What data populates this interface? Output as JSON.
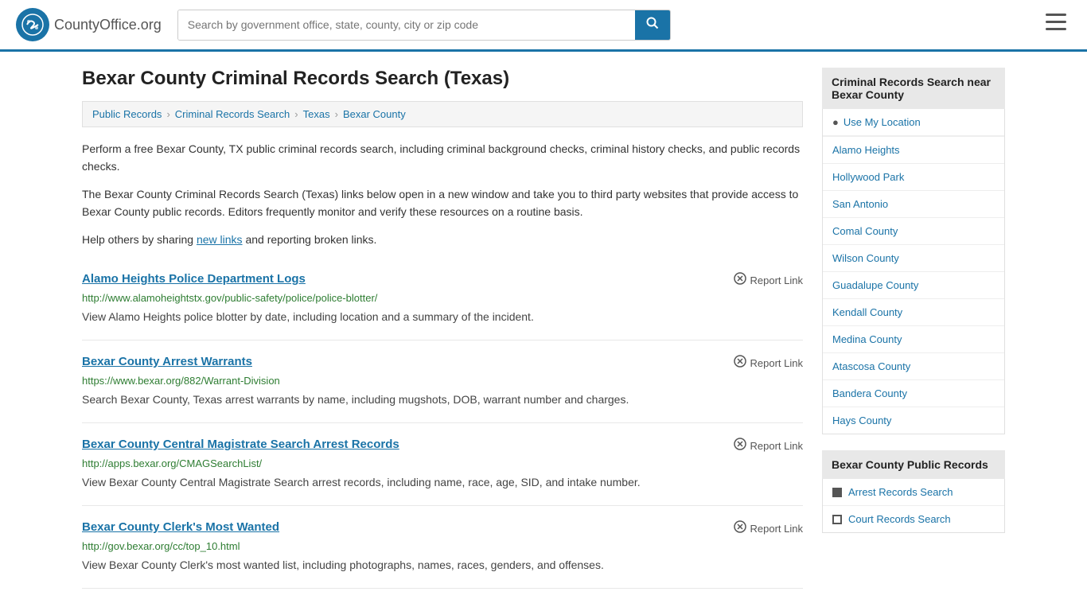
{
  "header": {
    "logo_text": "CountyOffice",
    "logo_suffix": ".org",
    "search_placeholder": "Search by government office, state, county, city or zip code",
    "search_value": ""
  },
  "page": {
    "title": "Bexar County Criminal Records Search (Texas)",
    "breadcrumb": [
      {
        "label": "Public Records",
        "href": "#"
      },
      {
        "label": "Criminal Records Search",
        "href": "#"
      },
      {
        "label": "Texas",
        "href": "#"
      },
      {
        "label": "Bexar County",
        "href": "#"
      }
    ],
    "description1": "Perform a free Bexar County, TX public criminal records search, including criminal background checks, criminal history checks, and public records checks.",
    "description2": "The Bexar County Criminal Records Search (Texas) links below open in a new window and take you to third party websites that provide access to Bexar County public records. Editors frequently monitor and verify these resources on a routine basis.",
    "description3_pre": "Help others by sharing ",
    "description3_link": "new links",
    "description3_post": " and reporting broken links."
  },
  "results": [
    {
      "title": "Alamo Heights Police Department Logs",
      "url": "http://www.alamoheightstx.gov/public-safety/police/police-blotter/",
      "description": "View Alamo Heights police blotter by date, including location and a summary of the incident.",
      "report_label": "Report Link"
    },
    {
      "title": "Bexar County Arrest Warrants",
      "url": "https://www.bexar.org/882/Warrant-Division",
      "description": "Search Bexar County, Texas arrest warrants by name, including mugshots, DOB, warrant number and charges.",
      "report_label": "Report Link"
    },
    {
      "title": "Bexar County Central Magistrate Search Arrest Records",
      "url": "http://apps.bexar.org/CMAGSearchList/",
      "description": "View Bexar County Central Magistrate Search arrest records, including name, race, age, SID, and intake number.",
      "report_label": "Report Link"
    },
    {
      "title": "Bexar County Clerk's Most Wanted",
      "url": "http://gov.bexar.org/cc/top_10.html",
      "description": "View Bexar County Clerk's most wanted list, including photographs, names, races, genders, and offenses.",
      "report_label": "Report Link"
    }
  ],
  "sidebar": {
    "nearby_title": "Criminal Records Search near Bexar County",
    "use_location_label": "Use My Location",
    "nearby_links": [
      "Alamo Heights",
      "Hollywood Park",
      "San Antonio",
      "Comal County",
      "Wilson County",
      "Guadalupe County",
      "Kendall County",
      "Medina County",
      "Atascosa County",
      "Bandera County",
      "Hays County"
    ],
    "public_records_title": "Bexar County Public Records",
    "public_records_links": [
      "Arrest Records Search",
      "Court Records Search"
    ]
  }
}
